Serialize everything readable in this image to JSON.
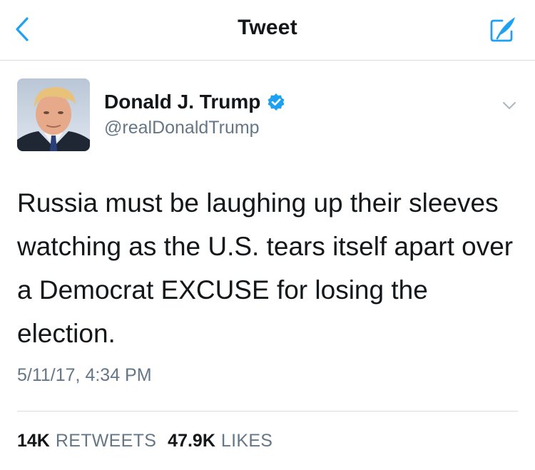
{
  "nav": {
    "title": "Tweet",
    "back_icon": "chevron-left-icon",
    "compose_icon": "compose-icon",
    "accent_color": "#1da1f2"
  },
  "author": {
    "display_name": "Donald J. Trump",
    "screen_name": "@realDonaldTrump",
    "verified": true,
    "verified_color": "#1da1f2"
  },
  "tweet": {
    "text": "Russia must be laughing up their sleeves watching as the U.S. tears itself apart over a Democrat EXCUSE for losing the election.",
    "timestamp": "5/11/17, 4:34 PM"
  },
  "stats": {
    "retweets_count": "14K",
    "retweets_label": "RETWEETS",
    "likes_count": "47.9K",
    "likes_label": "LIKES"
  }
}
